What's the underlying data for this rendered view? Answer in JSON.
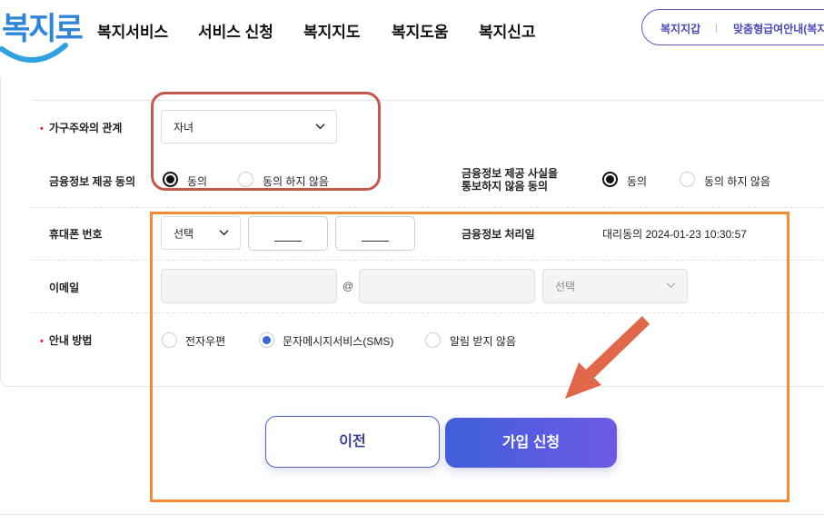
{
  "header": {
    "logo_text": "복지로",
    "nav": [
      "복지서비스",
      "서비스 신청",
      "복지지도",
      "복지도움",
      "복지신고"
    ],
    "util": [
      "복지지갑",
      "맞춤형급여안내(복지"
    ]
  },
  "form": {
    "relation": {
      "label": "가구주와의 관계",
      "value": "자녀"
    },
    "finance_consent": {
      "label": "금융정보 제공 동의",
      "options": [
        "동의",
        "동의 하지 않음"
      ],
      "selected": "동의"
    },
    "finance_notify": {
      "label_line1": "금융정보 제공 사실을",
      "label_line2": "통보하지 않음 동의",
      "options": [
        "동의",
        "동의 하지 않음"
      ],
      "selected": "동의"
    },
    "phone": {
      "label": "휴대폰 번호",
      "carrier_select": "선택"
    },
    "finance_date": {
      "label": "금융정보 처리일",
      "value": "대리동의 2024-01-23 10:30:57"
    },
    "email": {
      "label": "이메일",
      "at": "@",
      "domain_select": "선택"
    },
    "notice_method": {
      "label": "안내 방법",
      "options": [
        "전자우편",
        "문자메시지서비스(SMS)",
        "알림 받지 않음"
      ],
      "selected": "문자메시지서비스(SMS)"
    }
  },
  "buttons": {
    "prev": "이전",
    "submit": "가입 신청"
  },
  "colors": {
    "brand": "#2f86d8",
    "accent": "#4e61c9",
    "annotation_red": "#c4584a",
    "annotation_orange": "#f58a34"
  }
}
